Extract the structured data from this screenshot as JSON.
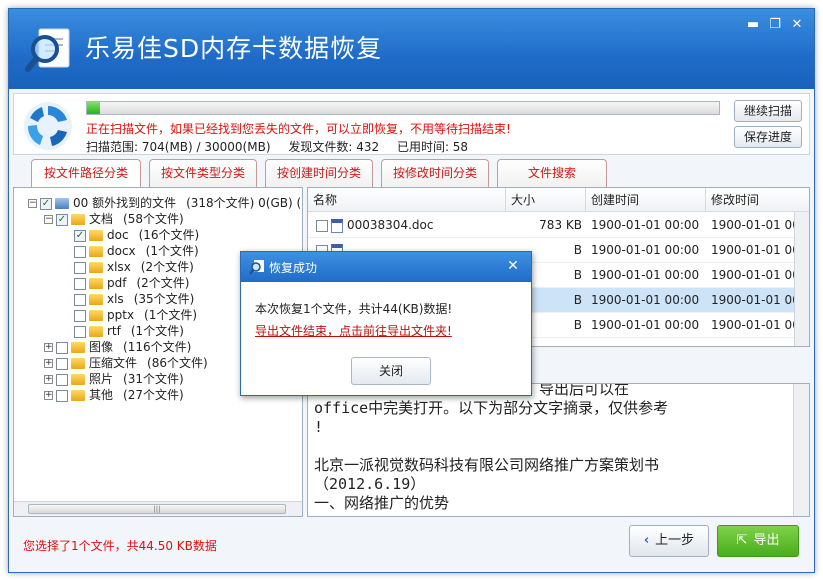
{
  "app": {
    "title": "乐易佳SD内存卡数据恢复",
    "minimize": "▬",
    "restore": "❐",
    "close": "✕"
  },
  "scan": {
    "progress_fraction": 0.02,
    "message": "正在扫描文件，如果已经找到您丢失的文件，可以立即恢复，不用等待扫描结束!",
    "range": "扫描范围: 704(MB) / 30000(MB)",
    "found": "发现文件数:  432",
    "elapsed": "已用时间: 58",
    "continue_label": "继续扫描",
    "save_label": "保存进度"
  },
  "tabs": [
    "按文件路径分类",
    "按文件类型分类",
    "按创建时间分类",
    "按修改时间分类",
    "文件搜索"
  ],
  "tree": {
    "root": {
      "name": "00  额外找到的文件",
      "count": "(318个文件) 0(GB) ("
    },
    "docs": {
      "name": "文档",
      "count": "(58个文件)"
    },
    "doc_types": [
      {
        "name": "doc",
        "count": "(16个文件)",
        "checked": true
      },
      {
        "name": "docx",
        "count": "(1个文件)",
        "checked": false
      },
      {
        "name": "xlsx",
        "count": "(2个文件)",
        "checked": false
      },
      {
        "name": "pdf",
        "count": "(2个文件)",
        "checked": false
      },
      {
        "name": "xls",
        "count": "(35个文件)",
        "checked": false
      },
      {
        "name": "pptx",
        "count": "(1个文件)",
        "checked": false
      },
      {
        "name": "rtf",
        "count": "(1个文件)",
        "checked": false
      }
    ],
    "groups": [
      {
        "name": "图像",
        "count": "(116个文件)"
      },
      {
        "name": "压缩文件",
        "count": "(86个文件)"
      },
      {
        "name": "照片",
        "count": "(31个文件)"
      },
      {
        "name": "其他",
        "count": "(27个文件)"
      }
    ]
  },
  "list": {
    "headers": [
      "名称",
      "大小",
      "创建时间",
      "修改时间"
    ],
    "rows": [
      {
        "name": "00038304.doc",
        "size": "783 KB",
        "created": "1900-01-01 00:00",
        "modified": "1900-01-01 00:0"
      },
      {
        "name": "",
        "size": "B",
        "created": "1900-01-01 00:00",
        "modified": "1900-01-01 00:0"
      },
      {
        "name": "",
        "size": "B",
        "created": "1900-01-01 00:00",
        "modified": "1900-01-01 00:0"
      },
      {
        "name": "",
        "size": "B",
        "created": "1900-01-01 00:00",
        "modified": "1900-01-01 00:0"
      },
      {
        "name": "",
        "size": "B",
        "created": "1900-01-01 00:00",
        "modified": "1900-01-01 00:0"
      }
    ]
  },
  "preview": {
    "lines": [
      "一些提示，此文件数据完全正确，导出后可以在",
      "office中完美打开。以下为部分文字摘录，仅供参考",
      "!",
      "",
      "北京一派视觉数码科技有限公司网络推广方案策划书",
      "（2012.6.19）",
      "一、网络推广的优势"
    ]
  },
  "status": "您选择了1个文件，共44.50 KB数据",
  "nav": {
    "back_label": "上一步",
    "export_label": "导出",
    "back_icon": "‹",
    "export_icon": "⇱"
  },
  "dialog": {
    "title": "恢复成功",
    "message": "本次恢复1个文件，共计44(KB)数据!",
    "link": "导出文件结束，点击前往导出文件夹!",
    "close_label": "关闭",
    "x_label": "✕"
  },
  "colors": {
    "title_blue": "#1f6cc8",
    "alert_red": "#e01010",
    "export_green": "#4aac1c"
  }
}
